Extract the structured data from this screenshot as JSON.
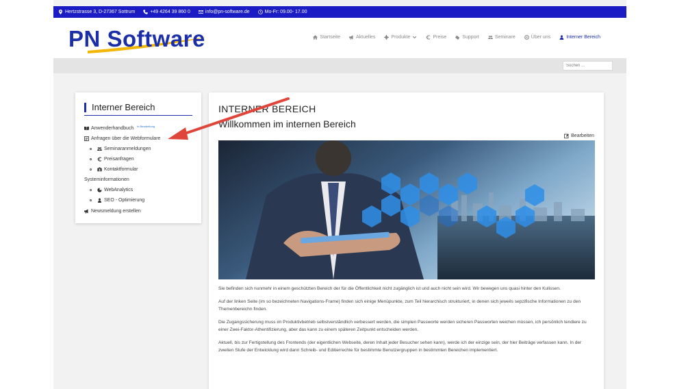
{
  "topbar": {
    "address": "Hertzstrasse 3, D-27367 Sottrum",
    "phone": "+49 4264 39 860 0",
    "email": "info@pn-software.de",
    "hours": "Mo-Fr: 09.00- 17.00"
  },
  "logo": {
    "text": "PN Software"
  },
  "nav": {
    "items": [
      {
        "label": "Startseite",
        "icon": "home-icon"
      },
      {
        "label": "Aktuelles",
        "icon": "megaphone-icon"
      },
      {
        "label": "Produkte",
        "icon": "gear-icon"
      },
      {
        "label": "Preise",
        "icon": "euro-icon"
      },
      {
        "label": "Support",
        "icon": "ticket-icon"
      },
      {
        "label": "Seminare",
        "icon": "group-icon"
      },
      {
        "label": "Über uns",
        "icon": "info-icon"
      },
      {
        "label": "Interner Bereich",
        "icon": "user-icon"
      }
    ]
  },
  "search": {
    "placeholder": "Suchen ..."
  },
  "sidebar": {
    "title": "Interner Bereich",
    "items": [
      {
        "label": "Anwenderhandbuch",
        "badge": "in Bearbeitung",
        "icon": "book-icon"
      },
      {
        "label": "Anfragen über die Webformulare",
        "icon": "form-icon"
      },
      {
        "label": "Seminaranmeldungen",
        "icon": "group-icon"
      },
      {
        "label": "Preisanfragen",
        "icon": "euro-icon"
      },
      {
        "label": "Kontaktformular",
        "icon": "contact-icon"
      },
      {
        "label": "Systeminformationen"
      },
      {
        "label": "WebAnalytics",
        "icon": "chart-icon"
      },
      {
        "label": "SEO - Optimierung",
        "icon": "user-icon"
      },
      {
        "label": "Newsmeldung erstellen",
        "icon": "megaphone-icon"
      }
    ]
  },
  "main": {
    "heading": "INTERNER BEREICH",
    "subheading": "Willkommen im internen Bereich",
    "edit_label": "Bearbeiten",
    "paragraphs": [
      "Sie befinden sich nunmehr in einem geschützten Bereich der für die Öffentlichkeit nicht zugänglich ist und auch nicht sein wird. Wir bewegen uns quasi hinter den Kulissen.",
      "Auf der linken Seite (im so bezeichneten Navigations-Frame) finden sich einige Menüpunkte, zum Teil hierarchisch strukturiert, in denen sich jeweils sepzifische Informationen zu den Themenbereichn finden.",
      "Die Zugangssicherung muss im Produktivbetrieb selbstverständlich verbessert werden, die simplen Passworte werden sicheren Passworten weichen müssen, ich persönlich tendiere zu einer Zwei-Faktor-Athentifizierung, aber das kann zu einem späteren Zeitpunkt entscheiden werden.",
      "Aktuell, bis zur Fertigstellung des Frontends (der eigentlichen Webseite, deren Inhalt jeder Besucher sehen kann), werde ich der einzige sein, der hier Beiträge verfassen kann. In der zweiten Stufe der Entwicklung wird dann Schreib- und Editierrechte für bestimmte Benutzergruppen in bestimmten Bereichen implementiert."
    ]
  },
  "colors": {
    "brand": "#1c2fa8",
    "topbar": "#1b1cc4",
    "arrow": "#e0453a",
    "logo_swoosh": "#f2b705"
  }
}
